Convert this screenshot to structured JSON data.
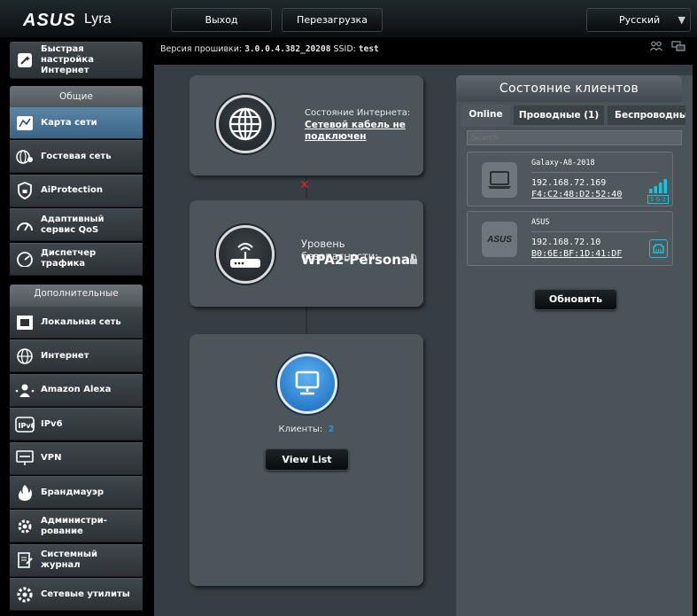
{
  "header": {
    "logo": "ASUS",
    "product": "Lyra",
    "logout_label": "Выход",
    "reboot_label": "Перезагрузка",
    "language": "Русский"
  },
  "info": {
    "firmware_label": "Версия прошивки:",
    "firmware_value": "3.0.0.4.382_20208",
    "ssid_label": "SSID:",
    "ssid_value": "test"
  },
  "sidebar": {
    "quick_setup": "Быстрая настройка Интернет",
    "general_header": "Общие",
    "general_items": [
      {
        "label": "Карта сети",
        "icon": "network-map-icon"
      },
      {
        "label": "Гостевая сеть",
        "icon": "guest-network-icon"
      },
      {
        "label": "AiProtection",
        "icon": "shield-icon"
      },
      {
        "label": "Адаптивный сервис QoS",
        "icon": "speedometer-icon"
      },
      {
        "label": "Диспетчер трафика",
        "icon": "gauge-icon"
      }
    ],
    "advanced_header": "Дополнительные настройки",
    "advanced_items": [
      {
        "label": "Локальная сеть",
        "icon": "lan-icon"
      },
      {
        "label": "Интернет",
        "icon": "globe-icon"
      },
      {
        "label": "Amazon Alexa",
        "icon": "alexa-icon"
      },
      {
        "label": "IPv6",
        "icon": "ipv6-icon"
      },
      {
        "label": "VPN",
        "icon": "vpn-icon"
      },
      {
        "label": "Брандмауэр",
        "icon": "firewall-icon"
      },
      {
        "label": "Администри-рование",
        "icon": "admin-gear-icon"
      },
      {
        "label": "Системный журнал",
        "icon": "log-icon"
      },
      {
        "label": "Сетевые утилиты",
        "icon": "tools-icon"
      }
    ]
  },
  "network_map": {
    "internet_status_label": "Состояние Интернета:",
    "internet_status_value": "Сетевой кабель не подключен",
    "security_label": "Уровень безопасности:",
    "security_value": "WPA2-Personal",
    "clients_label": "Клиенты:",
    "clients_count": "2",
    "view_list_label": "View List"
  },
  "client_status": {
    "title": "Состояние клиентов",
    "tabs": [
      "Online",
      "Проводные (1)",
      "Беспроводные"
    ],
    "active_tab": "Online",
    "search_placeholder": "Search",
    "clients": [
      {
        "name": "Galaxy-A8-2018",
        "ip": "192.168.72.169",
        "mac": "F4:C2:48:D2:52:40",
        "band": "5 G-2",
        "icon": "laptop-icon"
      },
      {
        "name": "ASUS",
        "ip": "192.168.72.10",
        "mac": "B0:6E:BF:1D:41:DF",
        "icon": "asus-device-icon"
      }
    ],
    "refresh_label": "Обновить"
  },
  "colors": {
    "accent": "#2f90e0",
    "status_cyan": "#19c3dc",
    "error_red": "#d02a2a"
  }
}
